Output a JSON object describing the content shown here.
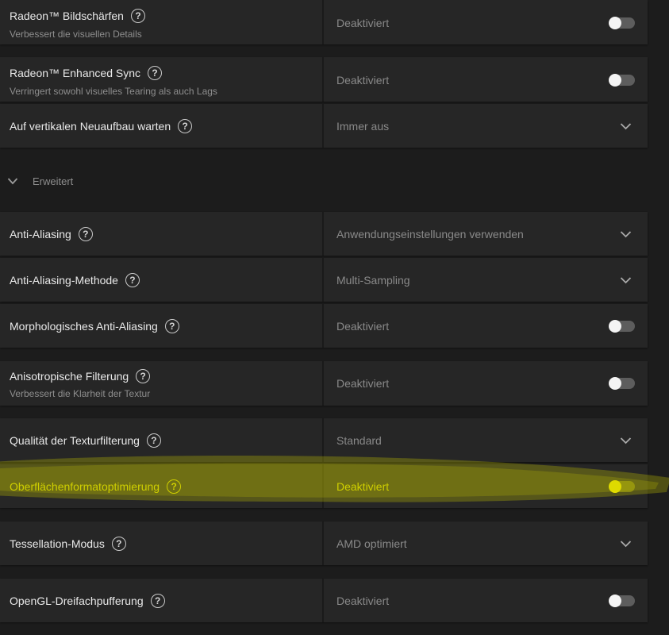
{
  "settings": {
    "bildschaerfen": {
      "title": "Radeon™ Bildschärfen",
      "subtitle": "Verbessert die visuellen Details",
      "value": "Deaktiviert",
      "enabled": false
    },
    "enhanced_sync": {
      "title": "Radeon™ Enhanced Sync",
      "subtitle": "Verringert sowohl visuelles Tearing als auch Lags",
      "value": "Deaktiviert",
      "enabled": false
    },
    "vsync": {
      "title": "Auf vertikalen Neuaufbau warten",
      "value": "Immer aus"
    },
    "advanced_section": {
      "label": "Erweitert"
    },
    "anti_aliasing": {
      "title": "Anti-Aliasing",
      "value": "Anwendungseinstellungen verwenden"
    },
    "aa_method": {
      "title": "Anti-Aliasing-Methode",
      "value": "Multi-Sampling"
    },
    "morphological_aa": {
      "title": "Morphologisches Anti-Aliasing",
      "value": "Deaktiviert",
      "enabled": false
    },
    "anisotropic": {
      "title": "Anisotropische Filterung",
      "subtitle": "Verbessert die Klarheit der Textur",
      "value": "Deaktiviert",
      "enabled": false
    },
    "texture_quality": {
      "title": "Qualität der Texturfilterung",
      "value": "Standard"
    },
    "surface_format": {
      "title": "Oberflächenformatoptimierung",
      "value": "Deaktiviert",
      "enabled": false
    },
    "tessellation": {
      "title": "Tessellation-Modus",
      "value": "AMD optimiert"
    },
    "opengl_triple": {
      "title": "OpenGL-Dreifachpufferung",
      "value": "Deaktiviert",
      "enabled": false
    }
  },
  "icons": {
    "help": "?",
    "help_icon_name": "help-circle-icon",
    "dropdown_icon_name": "chevron-down-icon"
  },
  "colors": {
    "background": "#1c1c1c",
    "row": "#262626",
    "highlighter": "#c8c800"
  }
}
